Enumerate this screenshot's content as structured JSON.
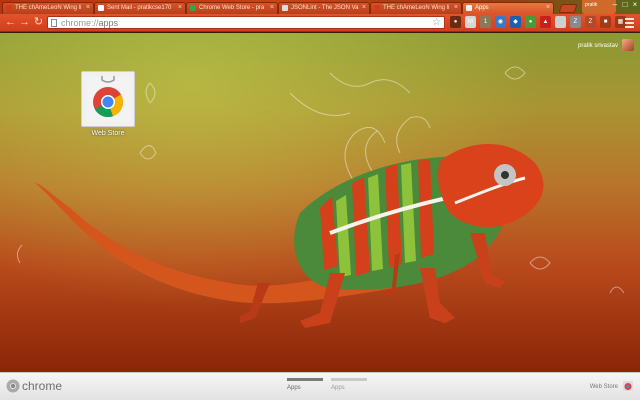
{
  "tabs": [
    {
      "title": "THE chAmeLeoN Wing li",
      "favicon_color": "#d33b1f"
    },
    {
      "title": "Sent Mail - pratikcse170",
      "favicon_color": "#ffffff"
    },
    {
      "title": "Chrome Web Store - pra",
      "favicon_color": "#3aa04a"
    },
    {
      "title": "JSONLint - The JSON Va",
      "favicon_color": "#dddddd"
    },
    {
      "title": "THE chAmeLeoN Wing li",
      "favicon_color": "#d33b1f"
    },
    {
      "title": "Apps",
      "favicon_color": "#f1f1f1",
      "active": true
    }
  ],
  "tab_close_glyph": "×",
  "window": {
    "user_chip": "pratik",
    "minimize": "–",
    "maximize": "□",
    "close": "×"
  },
  "toolbar": {
    "back_glyph": "←",
    "forward_glyph": "→",
    "reload_glyph": "↻",
    "url_scheme": "chrome://",
    "url_path": "apps",
    "star_glyph": "☆"
  },
  "extensions": [
    {
      "name": "shield-icon",
      "label": "●",
      "color": "#6b2a12"
    },
    {
      "name": "gmail-icon",
      "label": "M",
      "color": "#d5d5d5"
    },
    {
      "name": "badge-icon",
      "label": "1",
      "color": "#8a7a5a"
    },
    {
      "name": "globe-icon",
      "label": "◉",
      "color": "#3a78c8"
    },
    {
      "name": "ext-blue-icon",
      "label": "◆",
      "color": "#1e5fb0"
    },
    {
      "name": "ext-green-icon",
      "label": "●",
      "color": "#4a9a3a"
    },
    {
      "name": "ext-red-icon",
      "label": "▲",
      "color": "#c8201a"
    },
    {
      "name": "ext-blank-icon",
      "label": "",
      "color": "#cfcfcf"
    },
    {
      "name": "ext-z-icon",
      "label": "Z",
      "color": "#8a8a8a"
    },
    {
      "name": "ext-z2-icon",
      "label": "Z",
      "color": "#b14a2a"
    },
    {
      "name": "ext-square-icon",
      "label": "■",
      "color": "#a43a1a"
    },
    {
      "name": "ext-grid-icon",
      "label": "▦",
      "color": "#9a3a1a"
    }
  ],
  "user": {
    "name": "pratik srivastav"
  },
  "apps": [
    {
      "label": "Web Store"
    }
  ],
  "bottom": {
    "brand": "chrome",
    "pages": [
      {
        "label": "Apps",
        "active": true
      },
      {
        "label": "Apps",
        "active": false
      }
    ],
    "store_label": "Web Store"
  },
  "colors": {
    "tab_strip": "#c84214",
    "toolbar": "#e3532b",
    "accent": "#d8542a"
  }
}
